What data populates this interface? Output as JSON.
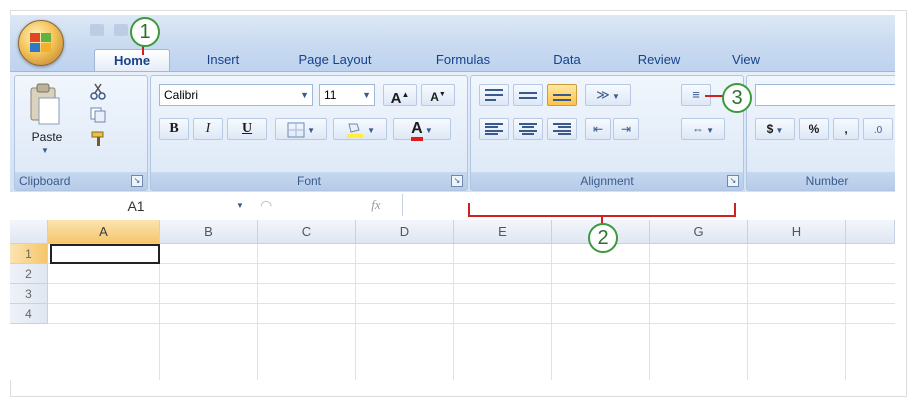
{
  "window": {
    "tabs": [
      "Home",
      "Insert",
      "Page Layout",
      "Formulas",
      "Data",
      "Review",
      "View"
    ],
    "active_tab": "Home"
  },
  "callouts": [
    "1",
    "2",
    "3"
  ],
  "ribbon": {
    "clipboard": {
      "label": "Clipboard",
      "paste_label": "Paste",
      "launcher_glyph": "↘"
    },
    "font": {
      "label": "Font",
      "font_name": "Calibri",
      "font_size": "11",
      "grow_font_glyph": "A",
      "shrink_font_glyph": "A",
      "bold": "B",
      "italic": "I",
      "underline": "U",
      "font_color_letter": "A",
      "launcher_glyph": "↘"
    },
    "alignment": {
      "label": "Alignment",
      "launcher_glyph": "↘"
    },
    "number": {
      "label": "Number",
      "currency": "$",
      "percent": "%",
      "comma": ","
    }
  },
  "formula_bar": {
    "name_box": "A1",
    "fx": "fx"
  },
  "grid": {
    "columns": [
      "A",
      "B",
      "C",
      "D",
      "E",
      "F",
      "G",
      "H"
    ],
    "rows": [
      "1",
      "2",
      "3",
      "4"
    ],
    "active_cell": "A1"
  },
  "colors": {
    "callout_ring": "#3c9a3c",
    "bracket": "#d02020",
    "accent": "#15428b"
  }
}
